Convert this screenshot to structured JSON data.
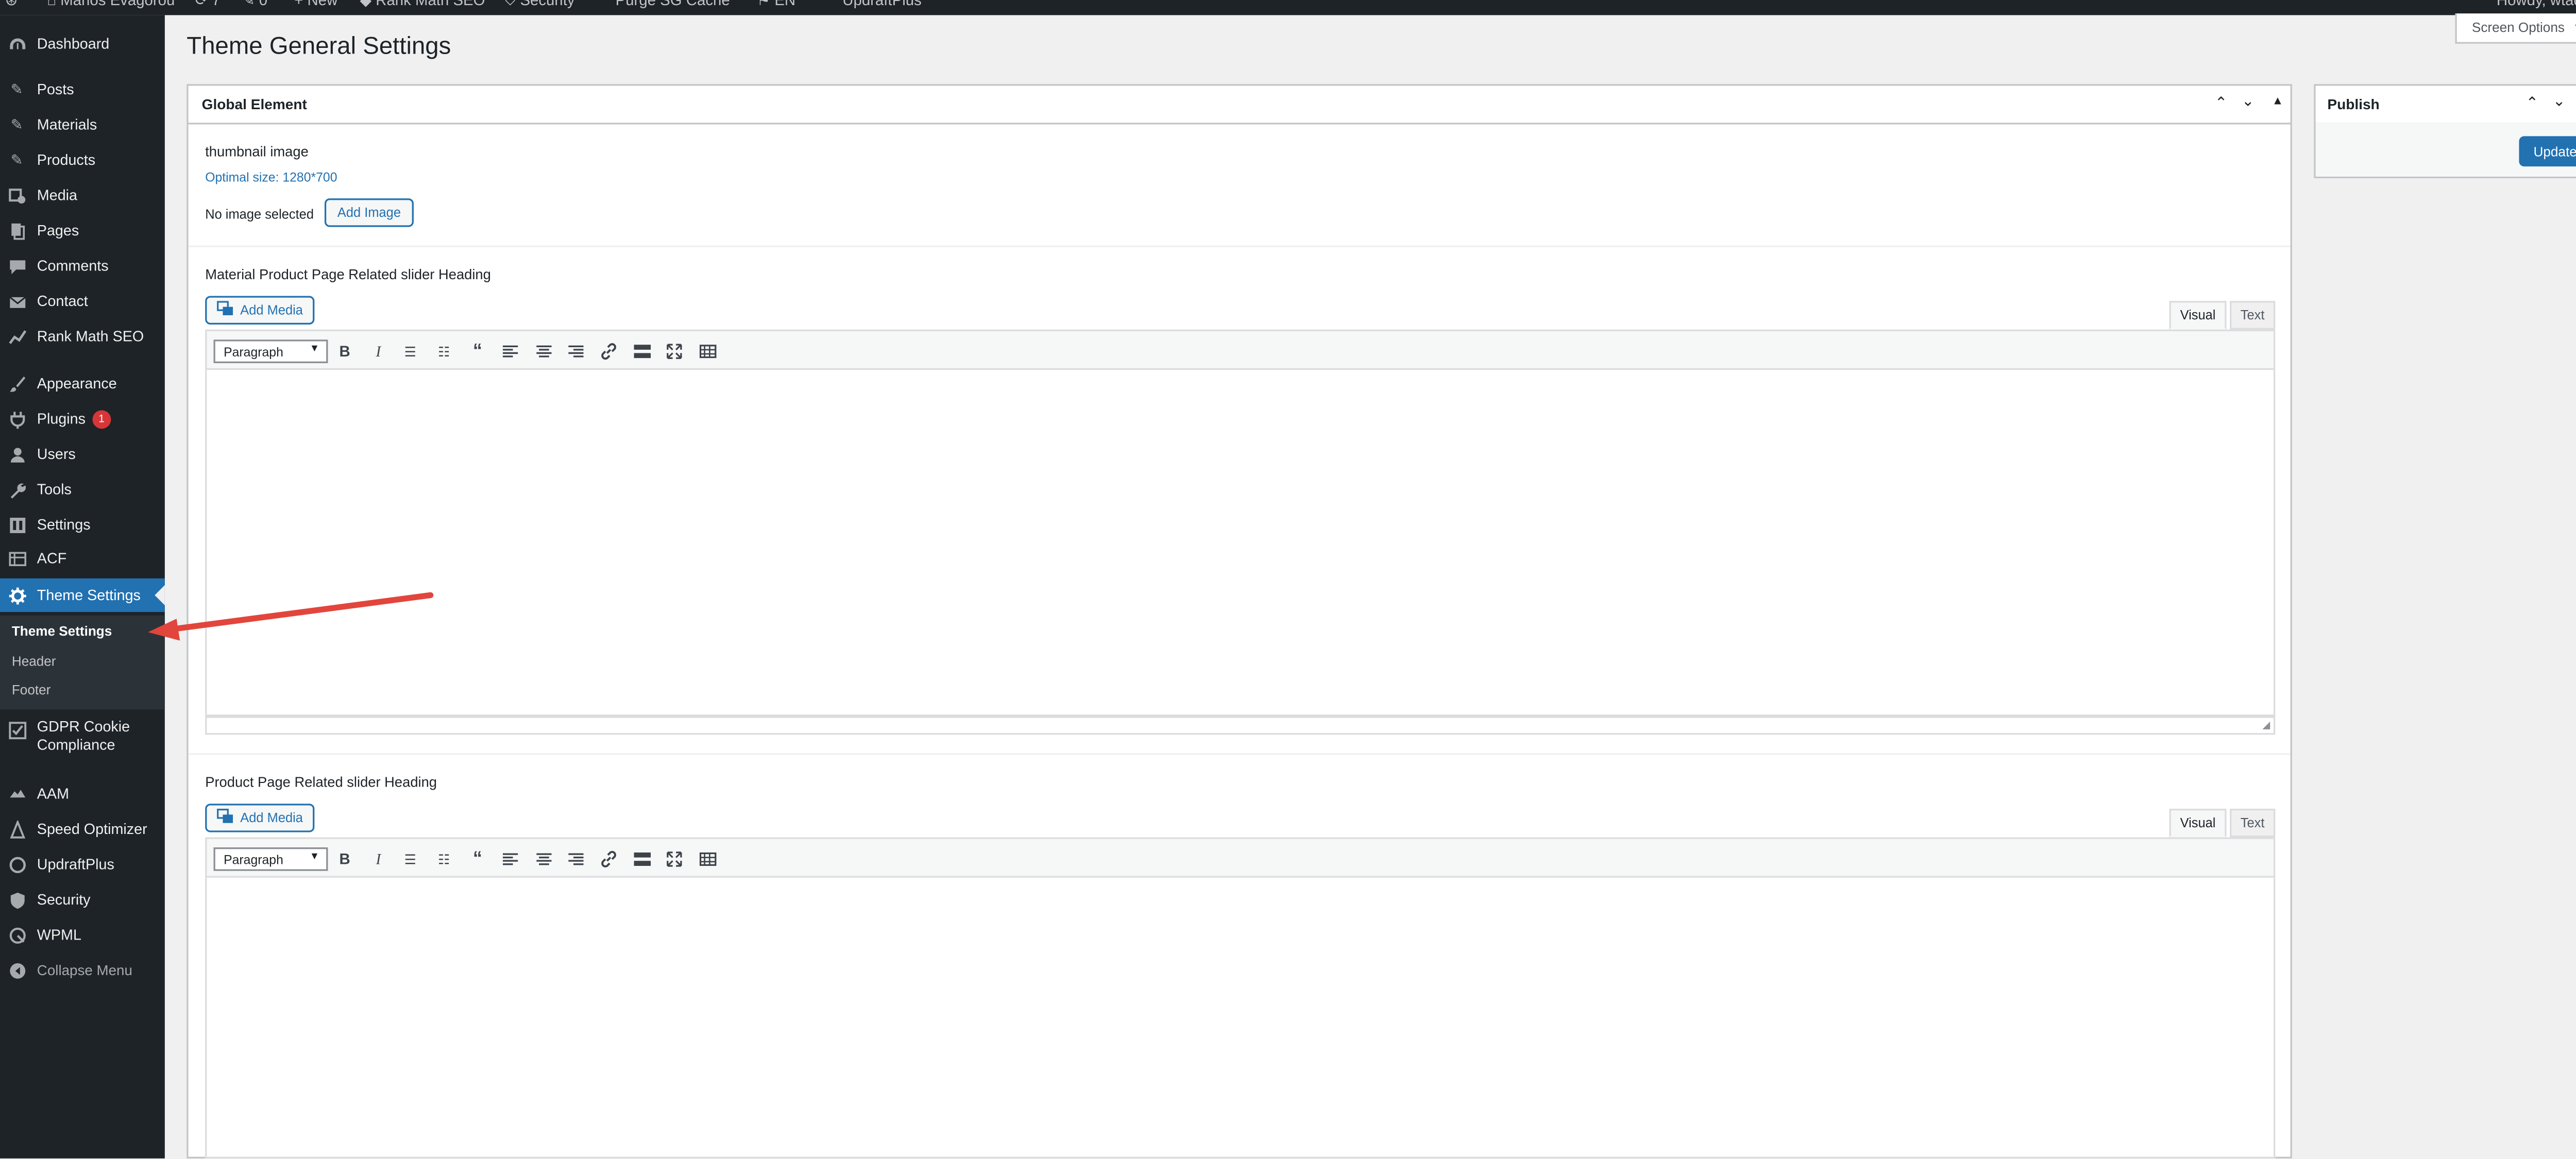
{
  "admin_bar": {
    "site_name": "Marios Evagorou",
    "new_label": "New",
    "rank_math_label": "Rank Math SEO",
    "security_label": "Security",
    "purge_label": "Purge SG Cache",
    "language_label": "EN",
    "updraft_label": "UpdraftPlus",
    "howdy": "Howdy, wtadmin"
  },
  "sidebar": {
    "items": [
      {
        "label": "Dashboard",
        "icon": "dashboard-icon"
      },
      {
        "label": "Posts",
        "icon": "pin-icon"
      },
      {
        "label": "Materials",
        "icon": "pin-icon"
      },
      {
        "label": "Products",
        "icon": "pin-icon"
      },
      {
        "label": "Media",
        "icon": "media-icon"
      },
      {
        "label": "Pages",
        "icon": "page-icon"
      },
      {
        "label": "Comments",
        "icon": "comment-icon"
      },
      {
        "label": "Contact",
        "icon": "mail-icon"
      },
      {
        "label": "Rank Math SEO",
        "icon": "chart-icon"
      },
      {
        "label": "Appearance",
        "icon": "brush-icon"
      },
      {
        "label": "Plugins",
        "icon": "plug-icon",
        "badge": "1"
      },
      {
        "label": "Users",
        "icon": "user-icon"
      },
      {
        "label": "Tools",
        "icon": "wrench-icon"
      },
      {
        "label": "Settings",
        "icon": "settings-icon"
      },
      {
        "label": "ACF",
        "icon": "table-icon"
      },
      {
        "label": "Theme Settings",
        "icon": "gear-icon"
      },
      {
        "label": "GDPR Cookie",
        "label2": "Compliance",
        "icon": "checkbox-icon"
      },
      {
        "label": "AAM",
        "icon": "aam-icon"
      },
      {
        "label": "Speed Optimizer",
        "icon": "speed-icon"
      },
      {
        "label": "UpdraftPlus",
        "icon": "updraft-icon"
      },
      {
        "label": "Security",
        "icon": "shield-icon"
      },
      {
        "label": "WPML",
        "icon": "wpml-icon"
      }
    ],
    "submenu": [
      "Theme Settings",
      "Header",
      "Footer"
    ],
    "collapse_label": "Collapse Menu"
  },
  "header": {
    "title": "Theme General Settings",
    "screen_options": "Screen Options"
  },
  "global_element": {
    "title": "Global Element",
    "thumbnail": {
      "label": "thumbnail image",
      "hint": "Optimal size: 1280*700",
      "no_image": "No image selected",
      "add_image": "Add Image"
    },
    "editors": [
      {
        "label": "Material Product Page Related slider Heading",
        "add_media": "Add Media",
        "tab_visual": "Visual",
        "tab_text": "Text",
        "format": "Paragraph"
      },
      {
        "label": "Product Page Related slider Heading",
        "add_media": "Add Media",
        "tab_visual": "Visual",
        "tab_text": "Text",
        "format": "Paragraph"
      }
    ]
  },
  "publish": {
    "title": "Publish",
    "update": "Update"
  },
  "colors": {
    "accent": "#2271b1",
    "sidebar": "#1d2327",
    "annotation_arrow": "#e2453c"
  }
}
